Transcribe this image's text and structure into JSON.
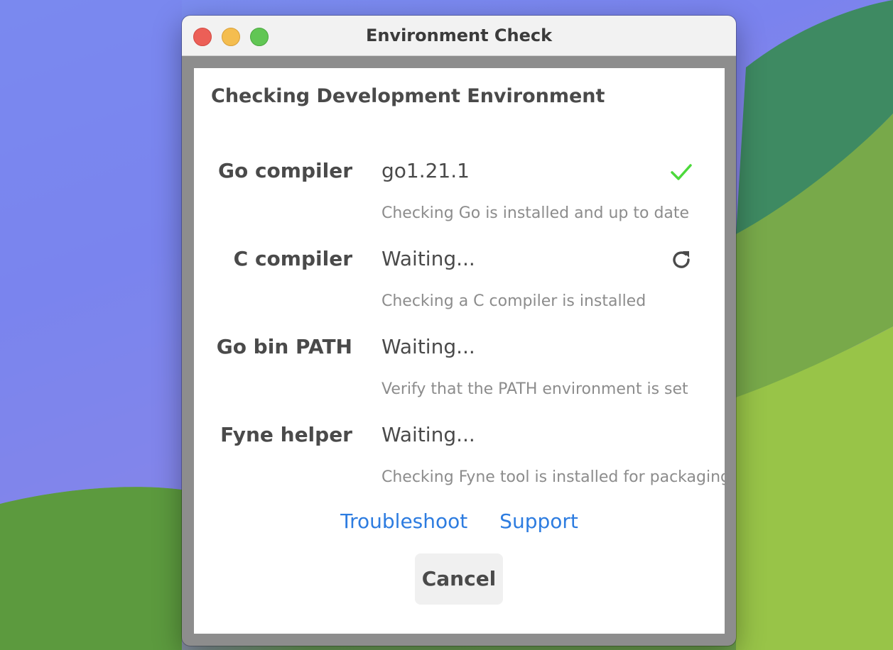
{
  "window": {
    "title": "Environment Check"
  },
  "dialog": {
    "heading": "Checking Development Environment",
    "checks": [
      {
        "label": "Go compiler",
        "value": "go1.21.1",
        "description": "Checking Go is installed and up to date",
        "status": "success",
        "status_icon": "checkmark-icon",
        "status_color": "#4cd93b"
      },
      {
        "label": "C compiler",
        "value": "Waiting...",
        "description": "Checking a C compiler is installed",
        "status": "in-progress",
        "status_icon": "refresh-icon",
        "status_color": "#4a4a4a"
      },
      {
        "label": "Go bin PATH",
        "value": "Waiting...",
        "description": "Verify that the PATH environment is set",
        "status": "pending"
      },
      {
        "label": "Fyne helper",
        "value": "Waiting...",
        "description": "Checking Fyne tool is installed for packaging",
        "status": "pending"
      }
    ],
    "links": {
      "troubleshoot": "Troubleshoot",
      "support": "Support"
    },
    "cancel_label": "Cancel"
  },
  "colors": {
    "link": "#2d7ce0",
    "text": "#4a4a4a",
    "muted": "#8c8c8c",
    "success": "#4cd93b"
  }
}
